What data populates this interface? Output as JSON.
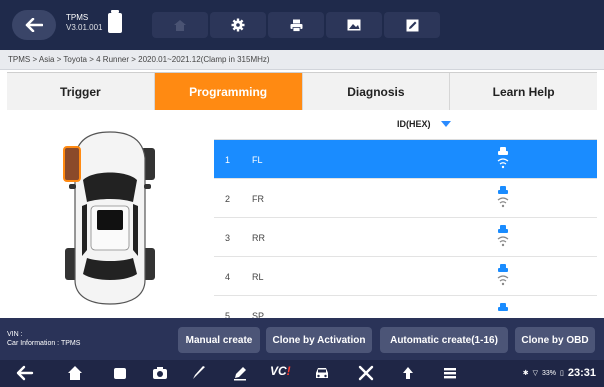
{
  "header": {
    "app_name": "TPMS",
    "version": "V3.01.001"
  },
  "breadcrumb": "TPMS > Asia > Toyota > 4 Runner > 2020.01~2021.12(Clamp in 315MHz)",
  "tabs": [
    "Trigger",
    "Programming",
    "Diagnosis",
    "Learn Help"
  ],
  "active_tab": "Programming",
  "table": {
    "column_header": "ID(HEX)",
    "rows": [
      {
        "num": "1",
        "pos": "FL"
      },
      {
        "num": "2",
        "pos": "FR"
      },
      {
        "num": "3",
        "pos": "RR"
      },
      {
        "num": "4",
        "pos": "RL"
      },
      {
        "num": "5",
        "pos": "SP"
      }
    ]
  },
  "footer": {
    "vin": "VIN :",
    "car_info": "Car Information : TPMS",
    "buttons": [
      "Manual create",
      "Clone by Activation",
      "Automatic create(1-16)",
      "Clone by OBD"
    ]
  },
  "status": {
    "battery": "33%",
    "time": "23:31"
  },
  "colors": {
    "accent": "#ff8a12",
    "selected_row": "#1a8cff",
    "header_bg": "#1f2a4b"
  }
}
